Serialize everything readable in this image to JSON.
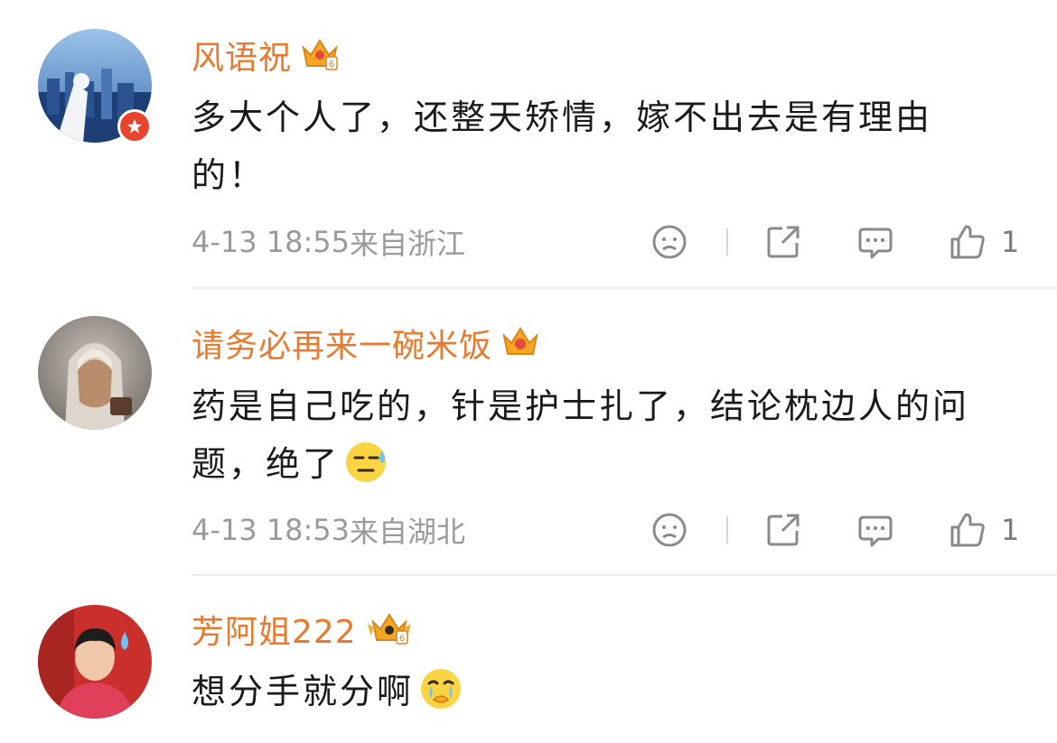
{
  "comments": [
    {
      "username": "风语祝",
      "text": "多大个人了，还整天矫情，嫁不出去是有理由的！",
      "date": "4-13 18:55",
      "region": "来自浙江",
      "likes": "1",
      "verified": true,
      "crown_badge": "6",
      "avatar_icon": "city-skyline-avatar"
    },
    {
      "username": "请务必再来一碗米饭",
      "text": "药是自己吃的，针是护士扎了，结论枕边人的问题，绝了",
      "emoji": "sweat-face-emoji",
      "date": "4-13 18:53",
      "region": "来自湖北",
      "likes": "1",
      "verified": false,
      "avatar_icon": "hooded-figure-avatar"
    },
    {
      "username": "芳阿姐222",
      "text": "想分手就分啊",
      "emoji": "crying-face-emoji",
      "verified": false,
      "crown_badge": "6",
      "avatar_icon": "person-photo-avatar"
    }
  ],
  "colors": {
    "username": "#e9792d",
    "text": "#1a1a1a",
    "meta": "#9a9a9a",
    "verified_badge": "#e8432f"
  },
  "icons": [
    "dislike-face-icon",
    "share-icon",
    "comment-icon",
    "thumbs-up-icon"
  ]
}
